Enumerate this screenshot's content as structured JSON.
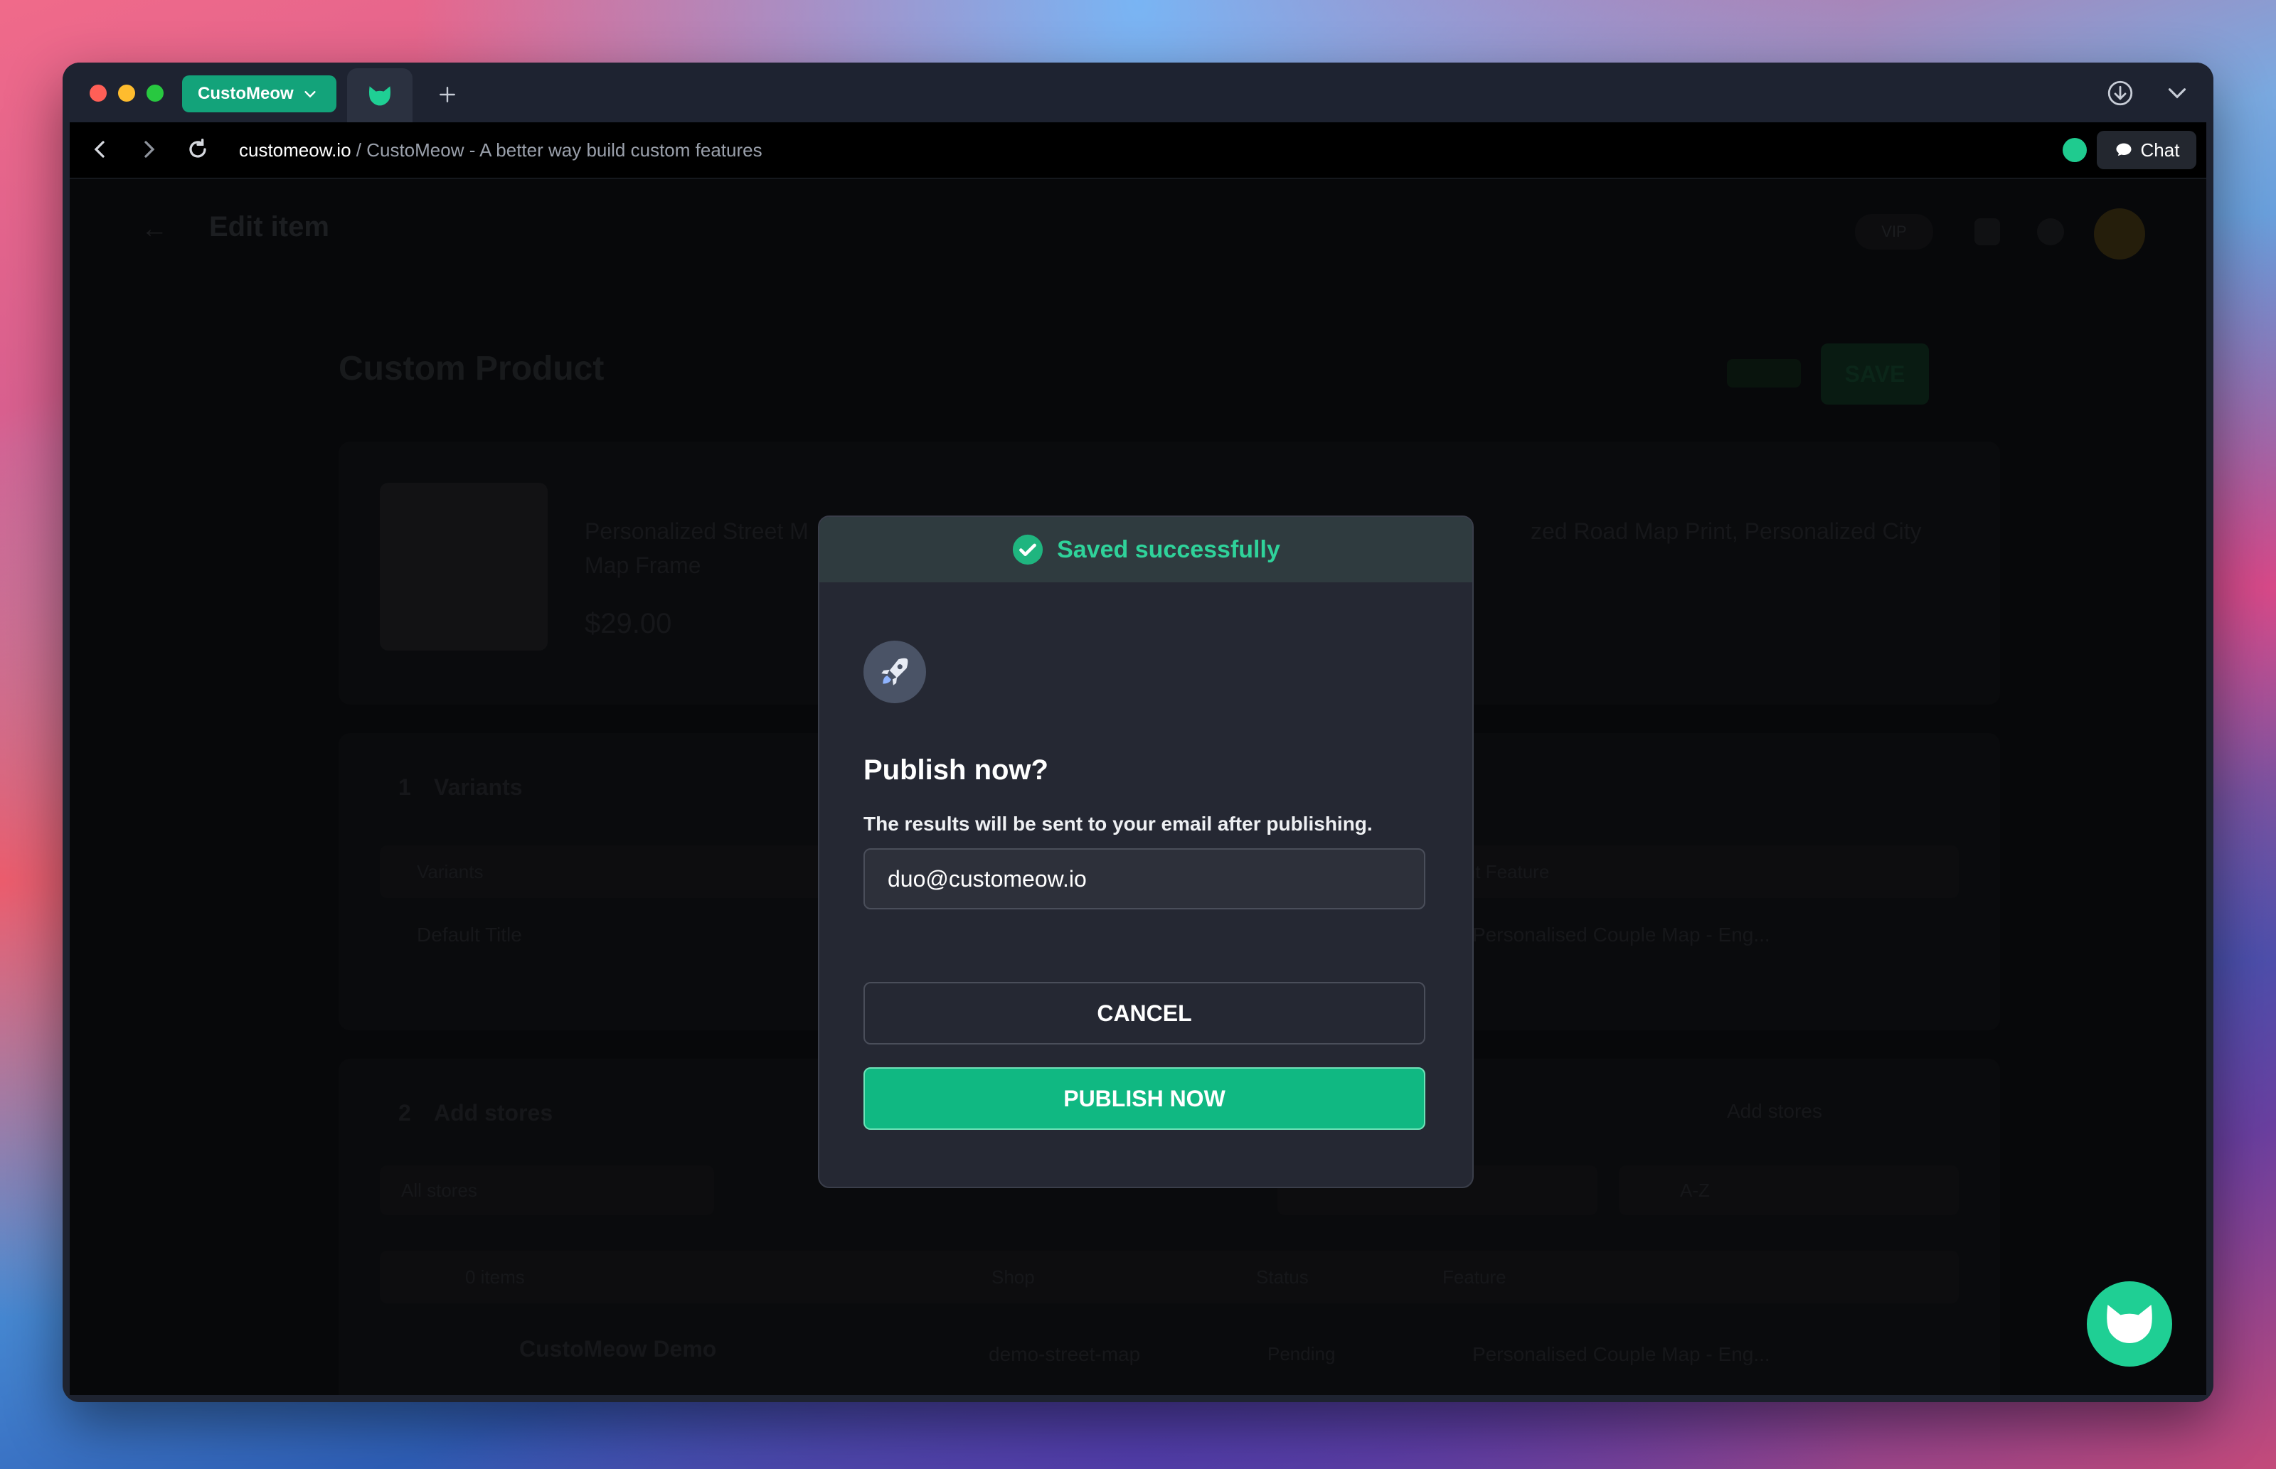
{
  "browser": {
    "profile_name": "CustoMeow",
    "url_domain": "customeow.io",
    "url_separator": " / ",
    "page_title": "CustoMeow - A better way build custom features",
    "chat_label": "Chat"
  },
  "background_page": {
    "header_title": "Edit item",
    "vip_label": "VIP",
    "page_title": "Custom Product",
    "save_label": "SAVE",
    "product_name_line1": "Personalized Street M",
    "product_name_line2": "Map Frame",
    "product_name_right": "zed Road Map Print, Personalized City",
    "product_price": "$29.00",
    "section1_num": "1",
    "section1_title": "Variants",
    "variants_col": "Variants",
    "print_feature_col": "Print Feature",
    "variant_row": "Default Title",
    "variant_feature": "Personalised Couple Map - Eng...",
    "section2_num": "2",
    "section2_title": "Add stores",
    "add_stores_link": "Add stores",
    "stores_filter": "All stores",
    "sort_value": "A-Z",
    "table_items": "0 items",
    "col_shop": "Shop",
    "col_status": "Status",
    "col_feature": "Feature",
    "store_name": "CustoMeow Demo",
    "store_handle": "demo-street-map",
    "store_status": "Pending",
    "store_feature": "Personalised Couple Map - Eng..."
  },
  "modal": {
    "toast_text": "Saved successfully",
    "title": "Publish now?",
    "description": "The results will be sent to your email after publishing.",
    "email_value": "duo@customeow.io",
    "cancel_label": "CANCEL",
    "publish_label": "PUBLISH NOW"
  },
  "colors": {
    "accent": "#10b882",
    "toast_text": "#2fd29a",
    "modal_bg": "#252833"
  },
  "icons": {
    "toast": "check-circle-icon",
    "modal": "rocket-icon",
    "fab": "cat-logo-icon"
  }
}
